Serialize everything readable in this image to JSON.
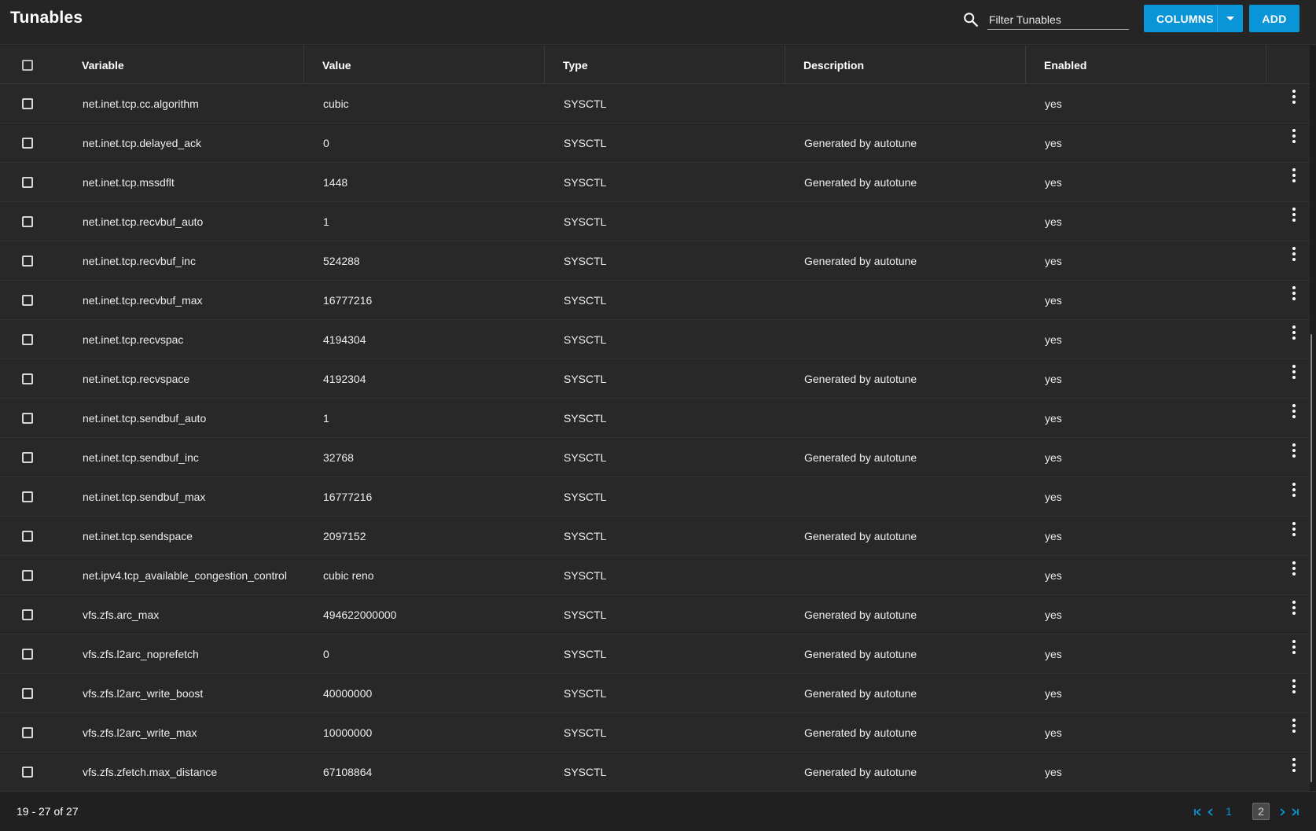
{
  "header": {
    "title": "Tunables",
    "search_placeholder": "Filter Tunables",
    "search_value": "",
    "columns_label": "COLUMNS",
    "add_label": "ADD",
    "accent_color": "#0a95d8"
  },
  "table": {
    "columns": [
      "Variable",
      "Value",
      "Type",
      "Description",
      "Enabled"
    ],
    "rows": [
      {
        "variable": "net.inet.tcp.cc.algorithm",
        "value": "cubic",
        "type": "SYSCTL",
        "description": "",
        "enabled": "yes"
      },
      {
        "variable": "net.inet.tcp.delayed_ack",
        "value": "0",
        "type": "SYSCTL",
        "description": "Generated by autotune",
        "enabled": "yes"
      },
      {
        "variable": "net.inet.tcp.mssdflt",
        "value": "1448",
        "type": "SYSCTL",
        "description": "Generated by autotune",
        "enabled": "yes"
      },
      {
        "variable": "net.inet.tcp.recvbuf_auto",
        "value": "1",
        "type": "SYSCTL",
        "description": "",
        "enabled": "yes"
      },
      {
        "variable": "net.inet.tcp.recvbuf_inc",
        "value": "524288",
        "type": "SYSCTL",
        "description": "Generated by autotune",
        "enabled": "yes"
      },
      {
        "variable": "net.inet.tcp.recvbuf_max",
        "value": "16777216",
        "type": "SYSCTL",
        "description": "",
        "enabled": "yes"
      },
      {
        "variable": "net.inet.tcp.recvspac",
        "value": "4194304",
        "type": "SYSCTL",
        "description": "",
        "enabled": "yes"
      },
      {
        "variable": "net.inet.tcp.recvspace",
        "value": "4192304",
        "type": "SYSCTL",
        "description": "Generated by autotune",
        "enabled": "yes"
      },
      {
        "variable": "net.inet.tcp.sendbuf_auto",
        "value": "1",
        "type": "SYSCTL",
        "description": "",
        "enabled": "yes"
      },
      {
        "variable": "net.inet.tcp.sendbuf_inc",
        "value": "32768",
        "type": "SYSCTL",
        "description": "Generated by autotune",
        "enabled": "yes"
      },
      {
        "variable": "net.inet.tcp.sendbuf_max",
        "value": "16777216",
        "type": "SYSCTL",
        "description": "",
        "enabled": "yes"
      },
      {
        "variable": "net.inet.tcp.sendspace",
        "value": "2097152",
        "type": "SYSCTL",
        "description": "Generated by autotune",
        "enabled": "yes"
      },
      {
        "variable": "net.ipv4.tcp_available_congestion_control",
        "value": "cubic reno",
        "type": "SYSCTL",
        "description": "",
        "enabled": "yes"
      },
      {
        "variable": "vfs.zfs.arc_max",
        "value": "494622000000",
        "type": "SYSCTL",
        "description": "Generated by autotune",
        "enabled": "yes"
      },
      {
        "variable": "vfs.zfs.l2arc_noprefetch",
        "value": "0",
        "type": "SYSCTL",
        "description": "Generated by autotune",
        "enabled": "yes"
      },
      {
        "variable": "vfs.zfs.l2arc_write_boost",
        "value": "40000000",
        "type": "SYSCTL",
        "description": "Generated by autotune",
        "enabled": "yes"
      },
      {
        "variable": "vfs.zfs.l2arc_write_max",
        "value": "10000000",
        "type": "SYSCTL",
        "description": "Generated by autotune",
        "enabled": "yes"
      },
      {
        "variable": "vfs.zfs.zfetch.max_distance",
        "value": "67108864",
        "type": "SYSCTL",
        "description": "Generated by autotune",
        "enabled": "yes"
      }
    ]
  },
  "footer": {
    "range_text": "19 - 27 of 27",
    "pages": [
      "1",
      "2"
    ],
    "current_page": "2"
  }
}
